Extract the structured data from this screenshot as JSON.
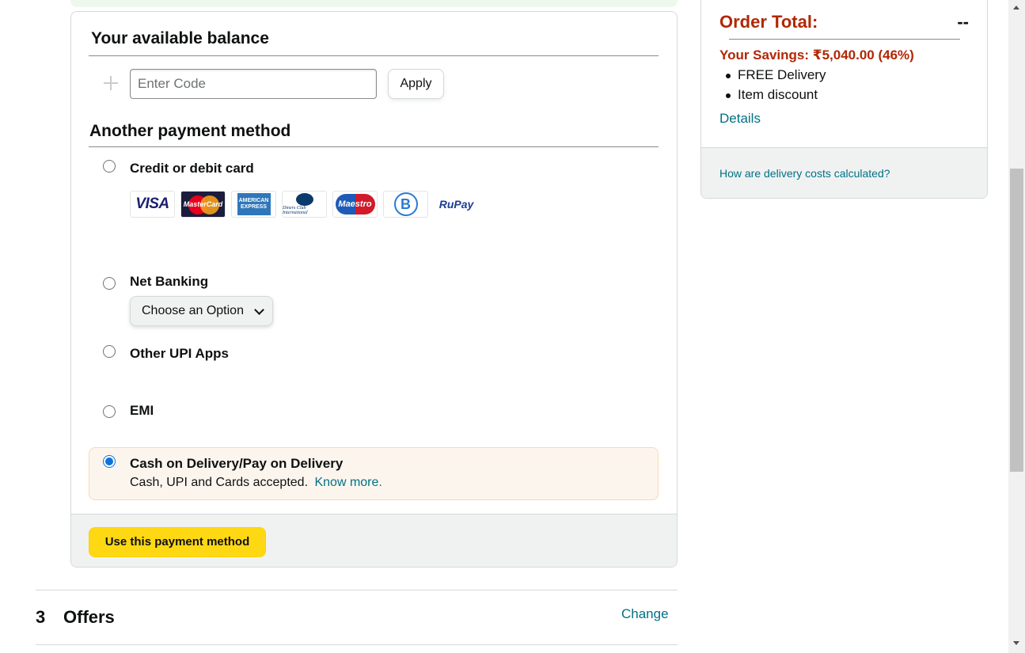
{
  "balance": {
    "title": "Your available balance",
    "code_placeholder": "Enter Code",
    "apply_label": "Apply"
  },
  "payment": {
    "title": "Another payment method",
    "options": {
      "card": {
        "label": "Credit or debit card",
        "selected": false
      },
      "netbanking": {
        "label": "Net Banking",
        "select_value": "Choose an Option",
        "selected": false
      },
      "upi": {
        "label": "Other UPI Apps",
        "selected": false
      },
      "emi": {
        "label": "EMI",
        "selected": false
      },
      "cod": {
        "label": "Cash on Delivery/Pay on Delivery",
        "sub": "Cash, UPI and Cards accepted.",
        "link": "Know more.",
        "selected": true
      }
    },
    "card_logos": {
      "visa": "VISA",
      "mastercard": "MasterCard",
      "amex": "AMERICAN EXPRESS",
      "diners": "Diners Club International",
      "maestro": "Maestro",
      "bharat": "B",
      "rupay": "RuPay"
    },
    "use_button": "Use this payment method"
  },
  "offers": {
    "number": "3",
    "title": "Offers",
    "change": "Change"
  },
  "summary": {
    "order_total_label": "Order Total:",
    "order_total_value": "--",
    "savings": "Your Savings: ₹5,040.00 (46%)",
    "items": [
      "FREE Delivery",
      "Item discount"
    ],
    "details": "Details",
    "delivery_link": "How are delivery costs calculated?"
  },
  "colors": {
    "accent_link": "#007185",
    "price_red": "#b12704",
    "button_yellow": "#ffd814",
    "radio_blue": "#0a74da"
  }
}
